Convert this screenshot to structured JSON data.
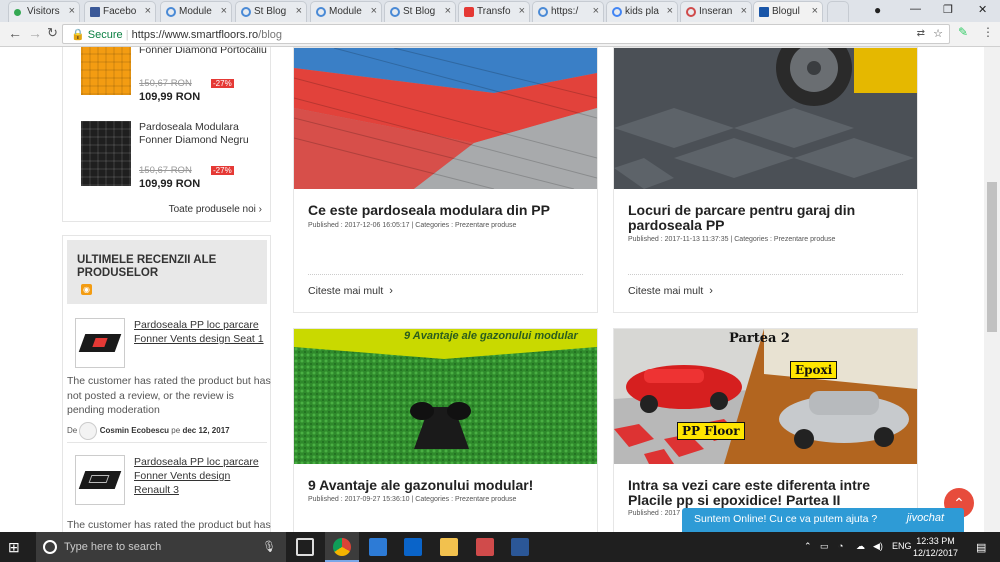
{
  "tabs": [
    {
      "label": "Visitors",
      "color": "#34a853"
    },
    {
      "label": "Facebo",
      "color": "#3b5998"
    },
    {
      "label": "Module",
      "color": "#4a8ad6"
    },
    {
      "label": "St Blog",
      "color": "#4a8ad6"
    },
    {
      "label": "Module",
      "color": "#4a8ad6"
    },
    {
      "label": "St Blog",
      "color": "#4a8ad6"
    },
    {
      "label": "Transfo",
      "color": "#e53935"
    },
    {
      "label": "https:/",
      "color": "#4a8ad6"
    },
    {
      "label": "kids pla",
      "color": "#4285f4"
    },
    {
      "label": "Inseran",
      "color": "#d04b4b"
    },
    {
      "label": "Blogul",
      "color": "#1a56a8"
    }
  ],
  "address": {
    "secure": "Secure",
    "url": "https://www.smartfloors.ro",
    "path": "/blog"
  },
  "sidebar": {
    "products": [
      {
        "name": "Fonner Diamond Portocaliu",
        "old_price": "150,67 RON",
        "discount": "-27%",
        "price": "109,99 RON",
        "color": "#f39c12"
      },
      {
        "name": "Pardoseala Modulara Fonner Diamond Negru",
        "old_price": "150,67 RON",
        "discount": "-27%",
        "price": "109,99 RON",
        "color": "#222222"
      }
    ],
    "all_products": "Toate produsele noi ›",
    "reviews_title": "ULTIMELE RECENZII ALE PRODUSELOR",
    "reviews": [
      {
        "product": "Pardoseala PP loc parcare Fonner Vents design Seat 1",
        "text": "The customer has rated the product but has not posted a review, or the review is pending moderation",
        "by_prefix": "De",
        "author": "Cosmin Ecobescu",
        "on": "pe",
        "date": "dec 12, 2017"
      },
      {
        "product": "Pardoseala PP loc parcare Fonner Vents design Renault 3",
        "text": "The customer has rated the product but has"
      }
    ]
  },
  "posts": [
    {
      "title": "Ce este pardoseala modulara din PP",
      "meta": "Published : 2017-12-06 16:05:17 | Categories : Prezentare produse",
      "more": "Citeste mai mult"
    },
    {
      "title": "Locuri de parcare pentru garaj din pardoseala PP",
      "meta": "Published : 2017-11-13 11:37:35 | Categories : Prezentare produse",
      "more": "Citeste mai mult"
    },
    {
      "title": "9 Avantaje ale gazonului modular!",
      "meta": "Published : 2017-09-27 15:36:10 | Categories : Prezentare produse",
      "img_text": "9 Avantaje ale gazonului modular"
    },
    {
      "title": "Intra sa vezi care este diferenta intre Placile pp si epoxidice! Partea II",
      "meta": "Published : 2017",
      "img_labels": [
        "Partea 2",
        "Epoxi",
        "PP Floor"
      ]
    }
  ],
  "chat": {
    "message": "Suntem Online! Cu ce va putem ajuta ?",
    "brand": "jivochat"
  },
  "taskbar": {
    "search_placeholder": "Type here to search",
    "lang": "ENG",
    "time": "12:33 PM",
    "date": "12/12/2017"
  }
}
